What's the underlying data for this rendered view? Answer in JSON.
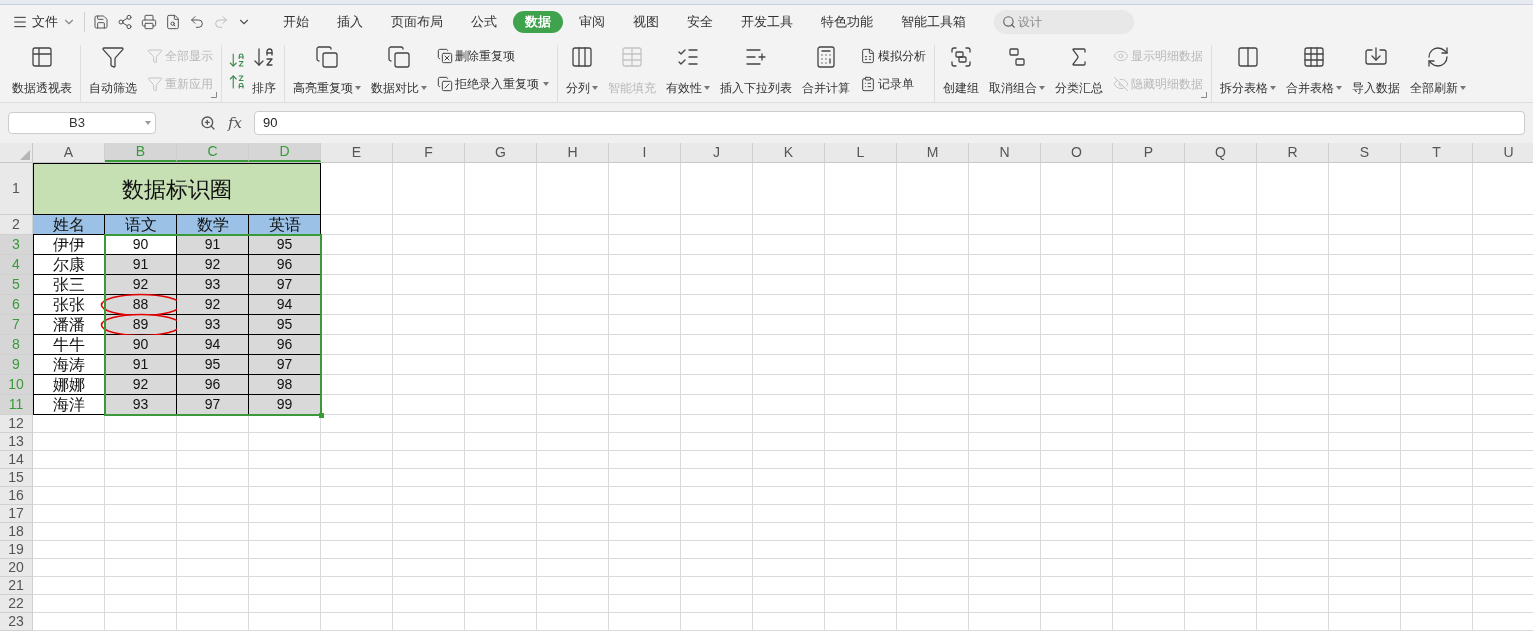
{
  "menu": {
    "file": "文件",
    "tabs": [
      {
        "label": "开始",
        "selected": false
      },
      {
        "label": "插入",
        "selected": false
      },
      {
        "label": "页面布局",
        "selected": false
      },
      {
        "label": "公式",
        "selected": false
      },
      {
        "label": "数据",
        "selected": true
      },
      {
        "label": "审阅",
        "selected": false
      },
      {
        "label": "视图",
        "selected": false
      },
      {
        "label": "安全",
        "selected": false
      },
      {
        "label": "开发工具",
        "selected": false
      },
      {
        "label": "特色功能",
        "selected": false
      },
      {
        "label": "智能工具箱",
        "selected": false
      }
    ],
    "search": {
      "placeholder": "设计"
    }
  },
  "ribbon": [
    {
      "items": [
        {
          "kind": "large",
          "label": "数据透视表",
          "disabled": false,
          "dropdown": false
        }
      ]
    },
    {
      "launcher": true,
      "items": [
        {
          "kind": "large",
          "label": "自动筛选",
          "disabled": false,
          "dropdown": false
        },
        {
          "kind": "small",
          "label": "全部显示",
          "disabled": true,
          "dropdown": false
        },
        {
          "kind": "small",
          "label": "重新应用",
          "disabled": true,
          "dropdown": false
        }
      ]
    },
    {
      "items": [
        {
          "kind": "sort",
          "label": "排序",
          "disabled": false,
          "dropdown": false
        }
      ]
    },
    {
      "items": [
        {
          "kind": "large",
          "label": "高亮重复项",
          "disabled": false,
          "dropdown": true
        },
        {
          "kind": "large",
          "label": "数据对比",
          "disabled": false,
          "dropdown": true
        },
        {
          "kind": "small",
          "label": "删除重复项",
          "disabled": false,
          "dropdown": false
        },
        {
          "kind": "small",
          "label": "拒绝录入重复项",
          "disabled": false,
          "dropdown": true
        }
      ]
    },
    {
      "items": [
        {
          "kind": "large",
          "label": "分列",
          "disabled": false,
          "dropdown": true
        },
        {
          "kind": "large",
          "label": "智能填充",
          "disabled": true,
          "dropdown": false
        },
        {
          "kind": "large",
          "label": "有效性",
          "disabled": false,
          "dropdown": true
        },
        {
          "kind": "large",
          "label": "插入下拉列表",
          "disabled": false,
          "dropdown": false
        },
        {
          "kind": "large",
          "label": "合并计算",
          "disabled": false,
          "dropdown": false
        },
        {
          "kind": "small",
          "label": "模拟分析",
          "disabled": false,
          "dropdown": false
        },
        {
          "kind": "small",
          "label": "记录单",
          "disabled": false,
          "dropdown": false
        }
      ]
    },
    {
      "launcher": true,
      "items": [
        {
          "kind": "large",
          "label": "创建组",
          "disabled": false,
          "dropdown": false
        },
        {
          "kind": "large",
          "label": "取消组合",
          "disabled": false,
          "dropdown": true
        },
        {
          "kind": "large",
          "label": "分类汇总",
          "disabled": false,
          "dropdown": false
        },
        {
          "kind": "small",
          "label": "显示明细数据",
          "disabled": true,
          "dropdown": false
        },
        {
          "kind": "small",
          "label": "隐藏明细数据",
          "disabled": true,
          "dropdown": false
        }
      ]
    },
    {
      "items": [
        {
          "kind": "large",
          "label": "拆分表格",
          "disabled": false,
          "dropdown": true
        },
        {
          "kind": "large",
          "label": "合并表格",
          "disabled": false,
          "dropdown": true
        },
        {
          "kind": "large",
          "label": "导入数据",
          "disabled": false,
          "dropdown": false
        },
        {
          "kind": "large",
          "label": "全部刷新",
          "disabled": false,
          "dropdown": true
        }
      ]
    }
  ],
  "formula_bar": {
    "name_box": "B3",
    "fx": "fx",
    "value": "90"
  },
  "sheet": {
    "columns": [
      {
        "label": "A",
        "selected": false
      },
      {
        "label": "B",
        "selected": true
      },
      {
        "label": "C",
        "selected": true
      },
      {
        "label": "D",
        "selected": true
      },
      {
        "label": "E",
        "selected": false
      },
      {
        "label": "F",
        "selected": false
      },
      {
        "label": "G",
        "selected": false
      },
      {
        "label": "H",
        "selected": false
      },
      {
        "label": "I",
        "selected": false
      },
      {
        "label": "J",
        "selected": false
      },
      {
        "label": "K",
        "selected": false
      },
      {
        "label": "L",
        "selected": false
      },
      {
        "label": "M",
        "selected": false
      },
      {
        "label": "N",
        "selected": false
      },
      {
        "label": "O",
        "selected": false
      },
      {
        "label": "P",
        "selected": false
      },
      {
        "label": "Q",
        "selected": false
      },
      {
        "label": "R",
        "selected": false
      },
      {
        "label": "S",
        "selected": false
      },
      {
        "label": "T",
        "selected": false
      },
      {
        "label": "U",
        "selected": false
      }
    ],
    "rows": [
      {
        "number": "1",
        "selected": false,
        "kind": "title",
        "title": "数据标识圈"
      },
      {
        "number": "2",
        "selected": false,
        "kind": "header",
        "cells": [
          "姓名",
          "语文",
          "数学",
          "英语"
        ]
      },
      {
        "number": "3",
        "selected": true,
        "kind": "data",
        "cells": [
          {
            "value": "伊伊"
          },
          {
            "value": "90",
            "selected": true,
            "active": true,
            "circled": false
          },
          {
            "value": "91",
            "selected": true,
            "active": false,
            "circled": false
          },
          {
            "value": "95",
            "selected": true,
            "active": false,
            "circled": false
          }
        ]
      },
      {
        "number": "4",
        "selected": true,
        "kind": "data",
        "cells": [
          {
            "value": "尔康"
          },
          {
            "value": "91",
            "selected": true,
            "active": false,
            "circled": false
          },
          {
            "value": "92",
            "selected": true,
            "active": false,
            "circled": false
          },
          {
            "value": "96",
            "selected": true,
            "active": false,
            "circled": false
          }
        ]
      },
      {
        "number": "5",
        "selected": true,
        "kind": "data",
        "cells": [
          {
            "value": "张三"
          },
          {
            "value": "92",
            "selected": true,
            "active": false,
            "circled": false
          },
          {
            "value": "93",
            "selected": true,
            "active": false,
            "circled": false
          },
          {
            "value": "97",
            "selected": true,
            "active": false,
            "circled": false
          }
        ]
      },
      {
        "number": "6",
        "selected": true,
        "kind": "data",
        "cells": [
          {
            "value": "张张"
          },
          {
            "value": "88",
            "selected": true,
            "active": false,
            "circled": true
          },
          {
            "value": "92",
            "selected": true,
            "active": false,
            "circled": false
          },
          {
            "value": "94",
            "selected": true,
            "active": false,
            "circled": false
          }
        ]
      },
      {
        "number": "7",
        "selected": true,
        "kind": "data",
        "cells": [
          {
            "value": "潘潘"
          },
          {
            "value": "89",
            "selected": true,
            "active": false,
            "circled": true
          },
          {
            "value": "93",
            "selected": true,
            "active": false,
            "circled": false
          },
          {
            "value": "95",
            "selected": true,
            "active": false,
            "circled": false
          }
        ]
      },
      {
        "number": "8",
        "selected": true,
        "kind": "data",
        "cells": [
          {
            "value": "牛牛"
          },
          {
            "value": "90",
            "selected": true,
            "active": false,
            "circled": false
          },
          {
            "value": "94",
            "selected": true,
            "active": false,
            "circled": false
          },
          {
            "value": "96",
            "selected": true,
            "active": false,
            "circled": false
          }
        ]
      },
      {
        "number": "9",
        "selected": true,
        "kind": "data",
        "cells": [
          {
            "value": "海涛"
          },
          {
            "value": "91",
            "selected": true,
            "active": false,
            "circled": false
          },
          {
            "value": "95",
            "selected": true,
            "active": false,
            "circled": false
          },
          {
            "value": "97",
            "selected": true,
            "active": false,
            "circled": false
          }
        ]
      },
      {
        "number": "10",
        "selected": true,
        "kind": "data",
        "cells": [
          {
            "value": "娜娜"
          },
          {
            "value": "92",
            "selected": true,
            "active": false,
            "circled": false
          },
          {
            "value": "96",
            "selected": true,
            "active": false,
            "circled": false
          },
          {
            "value": "98",
            "selected": true,
            "active": false,
            "circled": false
          }
        ]
      },
      {
        "number": "11",
        "selected": true,
        "kind": "data",
        "cells": [
          {
            "value": "海洋"
          },
          {
            "value": "93",
            "selected": true,
            "active": false,
            "circled": false
          },
          {
            "value": "97",
            "selected": true,
            "active": false,
            "circled": false
          },
          {
            "value": "99",
            "selected": true,
            "active": false,
            "circled": false
          }
        ]
      },
      {
        "number": "12",
        "selected": false,
        "kind": "empty"
      },
      {
        "number": "13",
        "selected": false,
        "kind": "empty"
      },
      {
        "number": "14",
        "selected": false,
        "kind": "empty"
      },
      {
        "number": "15",
        "selected": false,
        "kind": "empty"
      },
      {
        "number": "16",
        "selected": false,
        "kind": "empty"
      },
      {
        "number": "17",
        "selected": false,
        "kind": "empty"
      },
      {
        "number": "18",
        "selected": false,
        "kind": "empty"
      },
      {
        "number": "19",
        "selected": false,
        "kind": "empty"
      },
      {
        "number": "20",
        "selected": false,
        "kind": "empty"
      },
      {
        "number": "21",
        "selected": false,
        "kind": "empty"
      },
      {
        "number": "22",
        "selected": false,
        "kind": "empty"
      },
      {
        "number": "23",
        "selected": false,
        "kind": "empty"
      }
    ]
  }
}
